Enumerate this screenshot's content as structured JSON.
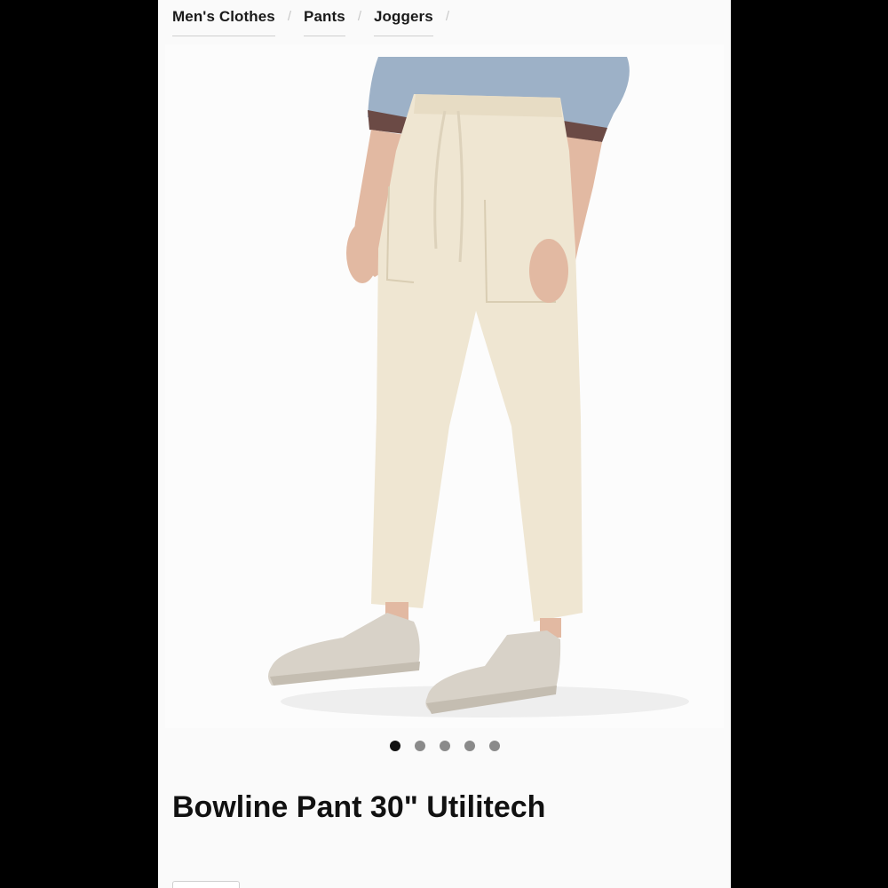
{
  "breadcrumb": {
    "items": [
      {
        "label": "Men's Clothes"
      },
      {
        "label": "Pants"
      },
      {
        "label": "Joggers"
      }
    ],
    "separator": "/"
  },
  "gallery": {
    "image_alt": "Model wearing cream jogger pants with light grey sneakers",
    "total_images": 5,
    "active_index": 0
  },
  "product": {
    "title": "Bowline Pant 30\" Utilitech"
  },
  "colors": {
    "pant": "#efe6d2",
    "sweater": "#9db1c7",
    "shoe": "#d8d2c8",
    "active_dot": "#111111",
    "inactive_dot": "#8a8a8a"
  }
}
